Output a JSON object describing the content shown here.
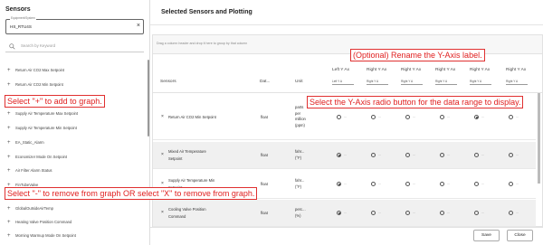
{
  "left": {
    "title": "Sensors",
    "system_label": "Equipment/System",
    "system_value": "HS_RTU4S",
    "search_placeholder": "Search by Keyword",
    "items": [
      {
        "label": "Return Air CO2 Max Setpoint"
      },
      {
        "label": "Return Air CO2 Min Setpoint"
      },
      {
        "label": "Supply Air Temperature Max Setpoint"
      },
      {
        "label": "Supply Air Temperature Min Setpoint"
      },
      {
        "label": "EA_Static_Alarm"
      },
      {
        "label": "Economizer Mode On Setpoint"
      },
      {
        "label": "Air Filter Alarm Status"
      },
      {
        "label": "FinTubeValve"
      },
      {
        "label": "GlobalOutsideAirTemp"
      },
      {
        "label": "Heating Valve Position Command"
      },
      {
        "label": "Morning Warmup Mode On Setpoint"
      }
    ]
  },
  "right": {
    "title": "Selected Sensors and Plotting",
    "group_hint": "Drag a column header and drop it here to group by that column",
    "headers": {
      "sensors": "Sensors",
      "datatype": "Dat...",
      "unit": "Unit",
      "axes": [
        "Left Y Ax",
        "Right Y Ax",
        "Right Y Ax",
        "Right Y Ax",
        "Right Y Ax",
        "Right Y Ax"
      ],
      "axis_inputs": [
        "Left Y A",
        "Right Y A",
        "Right Y A",
        "Right Y A",
        "Right Y A",
        "Right Y A"
      ]
    },
    "rows": [
      {
        "name": "Return Air CO2 Min Setpoint",
        "name2": "",
        "type": "float",
        "unit": [
          "parts",
          "per",
          "million",
          "(ppm)"
        ],
        "selected": 4
      },
      {
        "name": "Mixed Air Temperature",
        "name2": "Setpoint",
        "type": "float",
        "unit": [
          "fahr...",
          "(°F)"
        ],
        "selected": 0
      },
      {
        "name": "Supply Air Temperature Min",
        "name2": "Setpoint",
        "type": "float",
        "unit": [
          "fahr...",
          "(°F)"
        ],
        "selected": 0
      },
      {
        "name": "Cooling Valve Position",
        "name2": "Command",
        "type": "float",
        "unit": [
          "perc...",
          "(%)"
        ],
        "selected": 0
      }
    ],
    "save_label": "Save",
    "close_label": "Close"
  },
  "annotations": {
    "rename": "(Optional) Rename the Y-Axis label.",
    "add": "Select \"+\" to add to graph.",
    "radio": "Select the Y-Axis radio button for the data range to display.",
    "remove": "Select \"-\" to remove from graph OR select \"X\" to remove from graph."
  },
  "colors": {
    "annotation": "#e02020",
    "border": "#dddddd",
    "alt_row": "#f0f0f0"
  }
}
